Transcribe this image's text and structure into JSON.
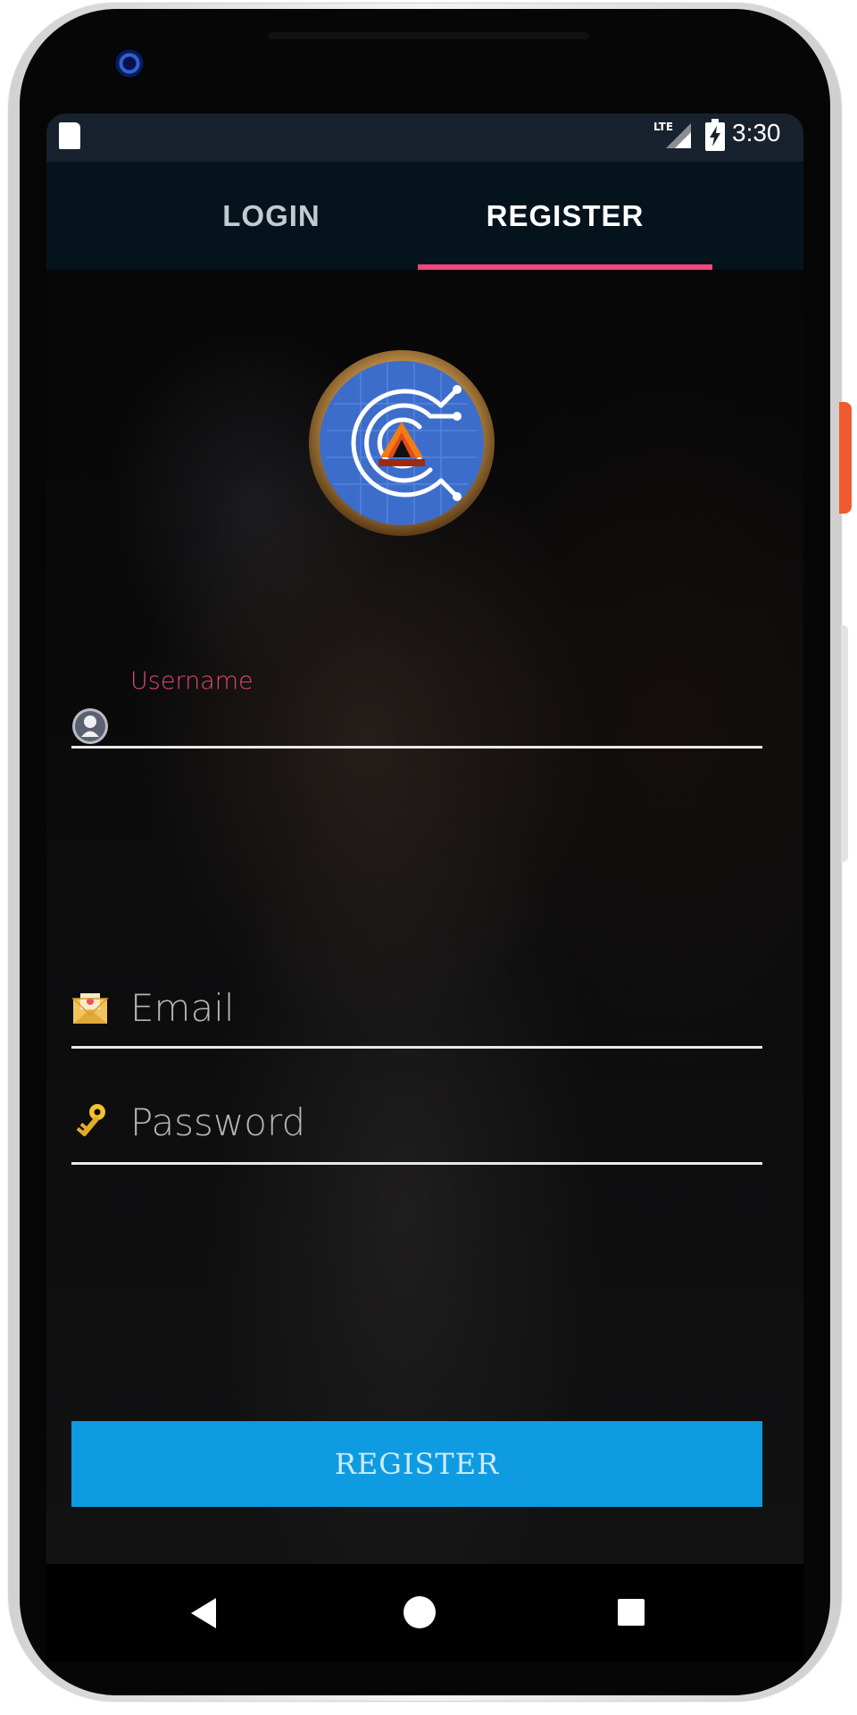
{
  "status_bar": {
    "network": "LTE",
    "time": "3:30"
  },
  "tabs": [
    {
      "label": "LOGIN",
      "selected": false
    },
    {
      "label": "REGISTER",
      "selected": true
    }
  ],
  "colors": {
    "accent": "#f4467e",
    "button": "#0e9be2",
    "tab_bar": "#05131d",
    "status_bar": "#18212e"
  },
  "form": {
    "username": {
      "label": "Username",
      "value": "",
      "icon": "user-icon"
    },
    "email": {
      "placeholder": "Email",
      "icon": "envelope-icon"
    },
    "password": {
      "placeholder": "Password",
      "icon": "key-icon"
    }
  },
  "register_button": {
    "label": "REGISTER"
  },
  "navigation": {
    "back": "back-icon",
    "home": "home-icon",
    "recents": "recents-icon"
  }
}
